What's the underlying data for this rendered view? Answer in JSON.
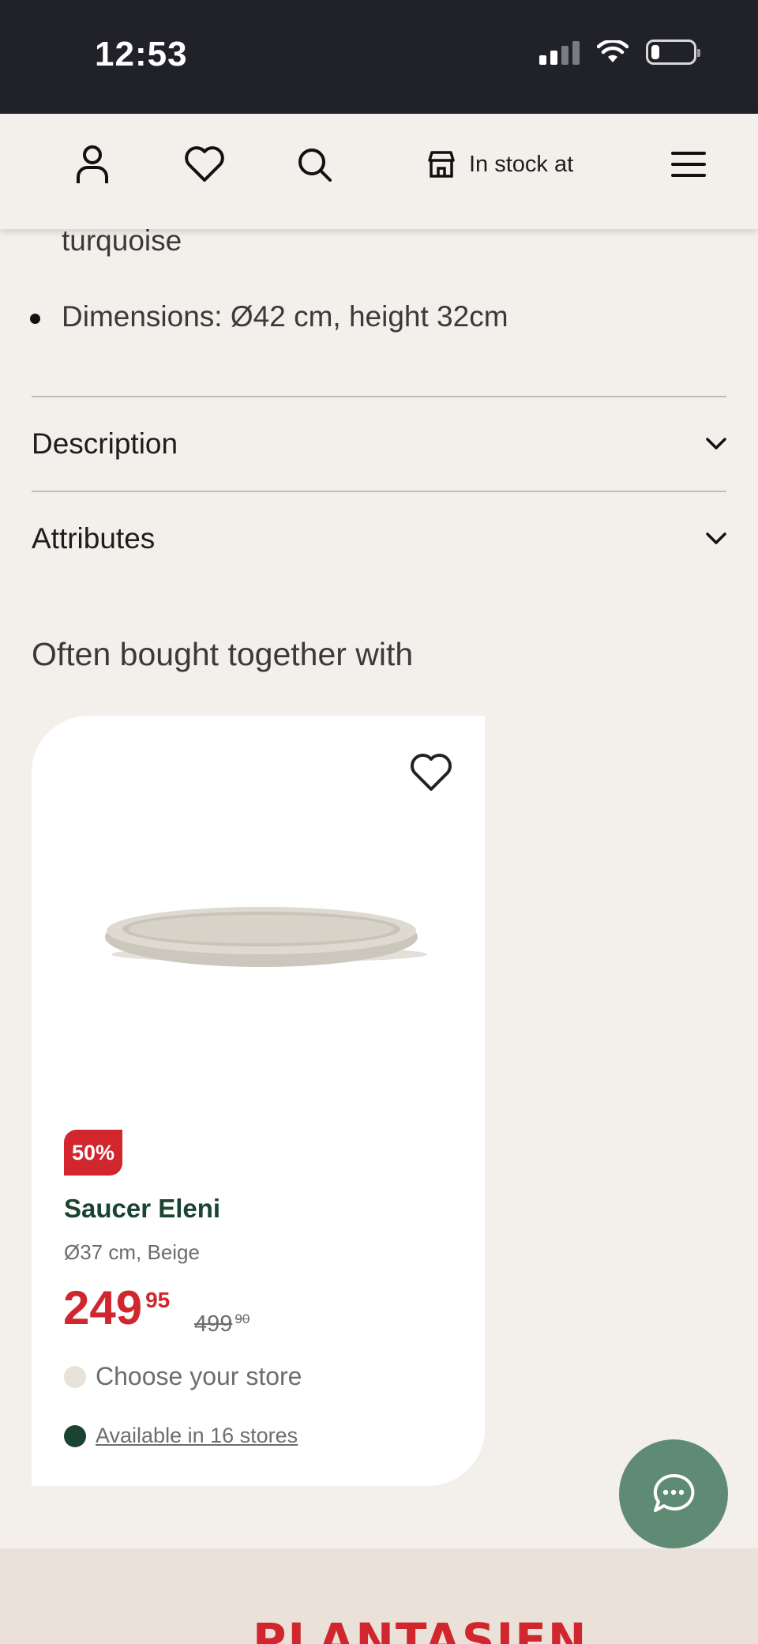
{
  "status_bar": {
    "time": "12:53",
    "battery_level": 0.2
  },
  "nav": {
    "icons": [
      "account-icon",
      "heart-icon",
      "search-icon",
      "store-icon",
      "menu-icon"
    ],
    "stock_label": "In stock at"
  },
  "specs": {
    "partial_line": "turquoise",
    "dimensions": "Dimensions: Ø42 cm, height 32cm"
  },
  "accordions": [
    {
      "label": "Description"
    },
    {
      "label": "Attributes"
    }
  ],
  "related": {
    "title": "Often bought together with",
    "product": {
      "discount": "50%",
      "name": "Saucer Eleni",
      "subtitle": "Ø37 cm, Beige",
      "price_int": "249",
      "price_dec": "95",
      "old_price_int": "499",
      "old_price_dec": "90",
      "store_label": "Choose your store",
      "availability": "Available in 16 stores"
    }
  },
  "colors": {
    "accent_red": "#d1262e",
    "brand_green": "#1b4332",
    "chat_green": "#5f8a74",
    "background": "#f3efeb"
  },
  "footer": {
    "logo": "PLANTASJEN"
  }
}
